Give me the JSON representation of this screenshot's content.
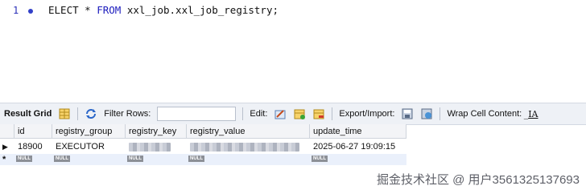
{
  "editor": {
    "line_number": "1",
    "sql_prefix": "ELECT * ",
    "sql_from": "FROM",
    "sql_suffix": " xxl_job.xxl_job_registry;"
  },
  "toolbar": {
    "result_grid_label": "Result Grid",
    "filter_rows_label": "Filter Rows:",
    "edit_label": "Edit:",
    "export_import_label": "Export/Import:",
    "wrap_cell_label": "Wrap Cell Content:",
    "wrap_icon_glyph": "̲IA"
  },
  "grid": {
    "columns": [
      "id",
      "registry_group",
      "registry_key",
      "registry_value",
      "update_time"
    ],
    "row": {
      "id": "18900",
      "registry_group": "EXECUTOR",
      "update_time": "2025-06-27 19:09:15"
    },
    "null_label": "NULL",
    "new_row_marker": "*"
  },
  "watermark": "掘金技术社区 @ 用户3561325137693"
}
